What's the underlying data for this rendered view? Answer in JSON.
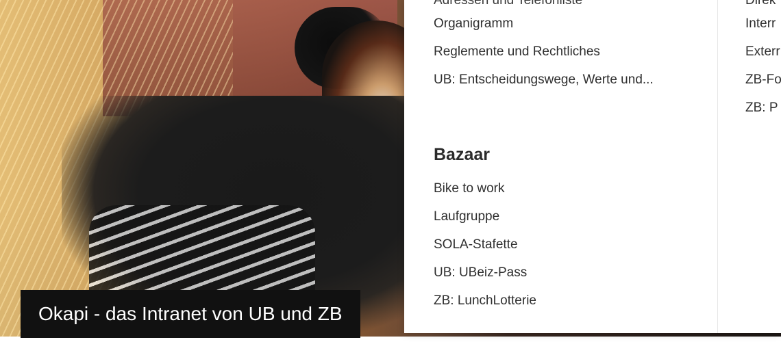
{
  "hero": {
    "caption": "Okapi - das Intranet von UB und ZB"
  },
  "menu": {
    "col1": {
      "top_cut_item": "Adressen und Telefonliste",
      "items_top": [
        "Organigramm",
        "Reglemente und Rechtliches",
        "UB: Entscheidungswege, Werte und..."
      ],
      "bazaar": {
        "title": "Bazaar",
        "items": [
          "Bike to work",
          "Laufgruppe",
          "SOLA-Stafette",
          "UB: UBeiz-Pass",
          "ZB: LunchLotterie"
        ]
      }
    },
    "col2": {
      "top_cut_item": "Direk",
      "items": [
        "Interr",
        "Exterr",
        "ZB-Fo",
        "ZB: P"
      ]
    }
  }
}
